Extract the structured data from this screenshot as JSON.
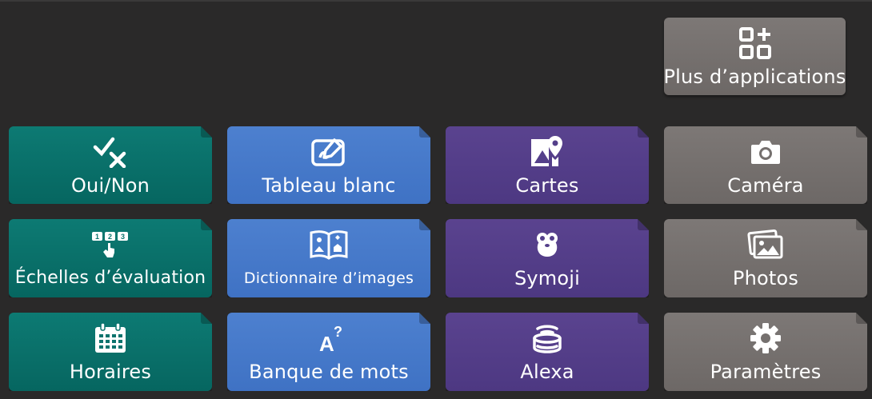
{
  "more_apps": {
    "label": "Plus d’applications",
    "icon": "apps-plus-icon"
  },
  "tiles": {
    "yes_no": {
      "label": "Oui/Non",
      "icon": "check-cross-icon",
      "color": "#0b736d"
    },
    "whiteboard": {
      "label": "Tableau blanc",
      "icon": "whiteboard-pen-icon",
      "color": "#4679ca"
    },
    "maps": {
      "label": "Cartes",
      "icon": "map-pin-icon",
      "color": "#543f8a"
    },
    "camera": {
      "label": "Caméra",
      "icon": "camera-icon",
      "color": "#75706e"
    },
    "rating_scales": {
      "label": "Échelles d’évaluation",
      "icon": "rating-scale-icon",
      "color": "#0b736d"
    },
    "image_dict": {
      "label": "Dictionnaire d’images",
      "icon": "picture-book-icon",
      "color": "#4679ca"
    },
    "symoji": {
      "label": "Symoji",
      "icon": "symoji-icon",
      "color": "#543f8a"
    },
    "photos": {
      "label": "Photos",
      "icon": "photos-icon",
      "color": "#75706e"
    },
    "schedules": {
      "label": "Horaires",
      "icon": "calendar-icon",
      "color": "#0b736d"
    },
    "word_bank": {
      "label": "Banque de mots",
      "icon": "word-bank-icon",
      "color": "#4679ca"
    },
    "alexa": {
      "label": "Alexa",
      "icon": "alexa-device-icon",
      "color": "#543f8a"
    },
    "settings": {
      "label": "Paramètres",
      "icon": "gear-icon",
      "color": "#75706e"
    }
  }
}
